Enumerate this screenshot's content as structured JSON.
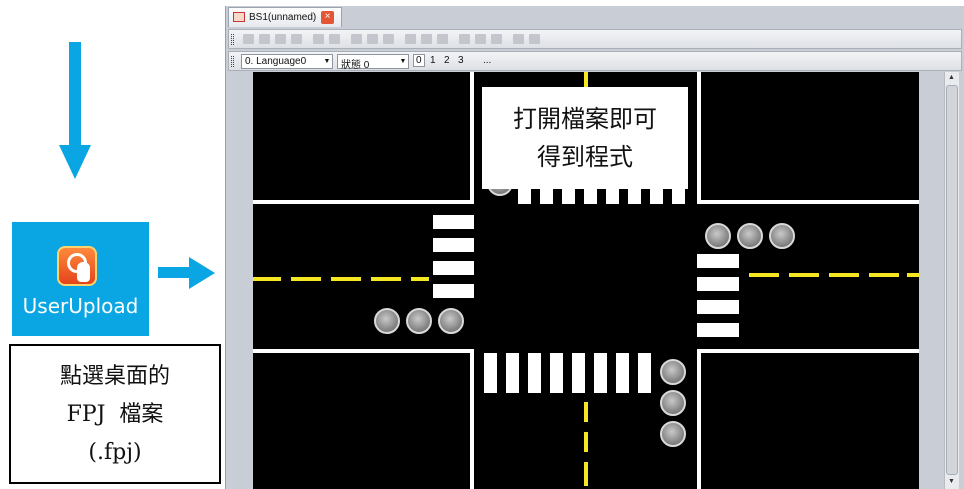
{
  "annotations": {
    "desktop_icon_label": "UserUpload",
    "caption_lines": [
      "點選桌面的",
      "FPJ  檔案",
      "(.fpj)"
    ],
    "callout_lines": [
      "打開檔案即可",
      "得到程式"
    ]
  },
  "window": {
    "tab_title": "BS1(unnamed)",
    "tab_close": "×",
    "language_select": "0.  Language0",
    "state_select": "狀態 0",
    "state_buttons": [
      "0",
      "1",
      "2",
      "3",
      "..."
    ]
  },
  "colors": {
    "accent_blue": "#0aa6e4",
    "road": "#000000",
    "lane_marking": "#f5e623",
    "crosswalk": "#ffffff",
    "light_off": "#8a8a8a"
  },
  "icons": {
    "arrow_down": "arrow-down-icon",
    "arrow_right": "arrow-right-icon",
    "app": "user-upload-icon",
    "traffic_light": "traffic-light-icon"
  }
}
